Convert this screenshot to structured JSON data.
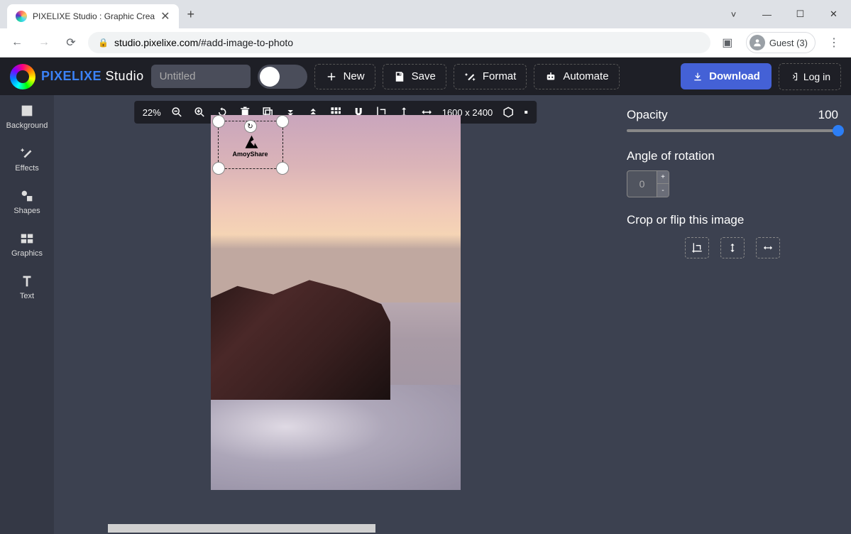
{
  "browser": {
    "tab_title": "PIXELIXE Studio : Graphic Crea",
    "url_host": "studio.pixelixe.com",
    "url_path": "/#add-image-to-photo",
    "guest_label": "Guest (3)"
  },
  "header": {
    "logo_brand": "PIXELIXE",
    "logo_suffix": "Studio",
    "title_placeholder": "Untitled",
    "new_label": "New",
    "save_label": "Save",
    "format_label": "Format",
    "automate_label": "Automate",
    "download_label": "Download",
    "login_label": "Log in"
  },
  "sidebar": {
    "items": [
      {
        "label": "Background"
      },
      {
        "label": "Effects"
      },
      {
        "label": "Shapes"
      },
      {
        "label": "Graphics"
      },
      {
        "label": "Text"
      }
    ]
  },
  "toolbar": {
    "zoom": "22%",
    "dimensions": "1600 x 2400"
  },
  "selection": {
    "logo_text": "AmoyShare"
  },
  "props": {
    "opacity_label": "Opacity",
    "opacity_value": "100",
    "rotation_label": "Angle of rotation",
    "rotation_value": "0",
    "crop_label": "Crop or flip this image"
  }
}
